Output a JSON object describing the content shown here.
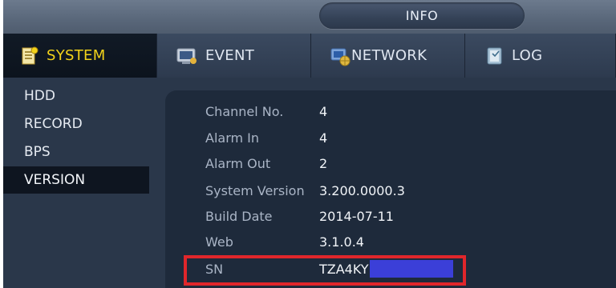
{
  "header": {
    "title": "INFO"
  },
  "tabs": [
    {
      "label": "SYSTEM",
      "icon": "system-doc-icon",
      "active": true
    },
    {
      "label": "EVENT",
      "icon": "event-monitor-icon",
      "active": false
    },
    {
      "label": "NETWORK",
      "icon": "network-globe-icon",
      "active": false
    },
    {
      "label": "LOG",
      "icon": "log-book-icon",
      "active": false
    }
  ],
  "sidebar": {
    "items": [
      {
        "label": "HDD",
        "active": false
      },
      {
        "label": "RECORD",
        "active": false
      },
      {
        "label": "BPS",
        "active": false
      },
      {
        "label": "VERSION",
        "active": true
      }
    ]
  },
  "version_info": {
    "rows": [
      {
        "label": "Channel No.",
        "value": "4"
      },
      {
        "label": "Alarm In",
        "value": "4"
      },
      {
        "label": "Alarm Out",
        "value": "2"
      },
      {
        "label": "System Version",
        "value": "3.200.0000.3"
      },
      {
        "label": "Build Date",
        "value": "2014-07-11"
      },
      {
        "label": "Web",
        "value": "3.1.0.4"
      },
      {
        "label": "SN",
        "value": "TZA4KY"
      }
    ]
  },
  "colors": {
    "active_tab_text": "#f2d21a",
    "highlight_border": "#e0262b",
    "redaction": "#3b3fd8"
  }
}
